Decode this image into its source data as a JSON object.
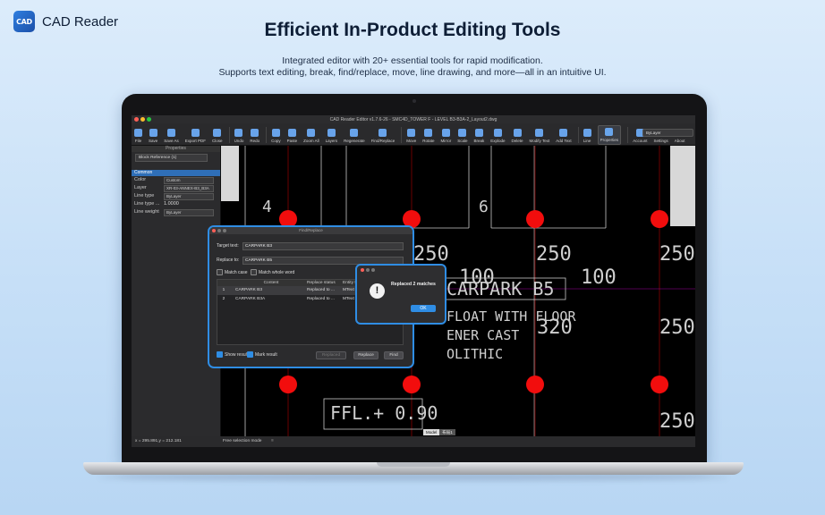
{
  "brand": {
    "logo_text": "CAD",
    "name": "CAD Reader"
  },
  "hero": {
    "title": "Efficient In-Product Editing Tools",
    "subtitle_line1": "Integrated editor with 20+ essential tools for rapid modification.",
    "subtitle_line2": "Supports text editing, break, find/replace, move, line drawing, and more—all in an intuitive UI."
  },
  "window": {
    "title": "CAD Reader Editor v1.7.6-26 - SMC4D_TOWER F - LEVEL B3-B3A-2_Layout2.dwg"
  },
  "toolbar": {
    "items": [
      "File",
      "Save",
      "Save As",
      "Export PDF",
      "Close",
      "Undo",
      "Redo",
      "Copy",
      "Paste",
      "Zoom All",
      "Layers",
      "Regenerate",
      "Find/Replace",
      "Move",
      "Rotate",
      "Mirror",
      "Scale",
      "Break",
      "Explode",
      "Delete",
      "Modify Text",
      "Add Text",
      "Line",
      "Properties",
      "Account",
      "Settings",
      "About"
    ],
    "layer_value": "ByLayer"
  },
  "properties": {
    "title": "Properties",
    "selector": "Block Reference (1)",
    "group": "Common",
    "rows": [
      {
        "key": "Color",
        "value": "Custom"
      },
      {
        "key": "Layer",
        "value": "XR-03-ANNEX-B3_B3A"
      },
      {
        "key": "Line type",
        "value": "ByLayer"
      },
      {
        "key": "Line type ...",
        "value": "1.0000"
      },
      {
        "key": "Line weight",
        "value": "ByLayer"
      }
    ]
  },
  "status": {
    "coords": "x = 295.891,y = 212.181",
    "mode": "Free selection mode",
    "tab_model": "Model",
    "tab_layout": "布局1"
  },
  "find_replace": {
    "title": "Find/Replace",
    "target_label": "Target text:",
    "target_value": "CARPARK B3",
    "replace_label": "Replace to:",
    "replace_value": "CARPARK B5",
    "match_case": "Match case",
    "match_whole": "Match whole word",
    "columns": [
      "",
      "Content",
      "Replace status",
      "Entity type"
    ],
    "rows": [
      {
        "n": "1",
        "content": "CARPARK B3",
        "status": "Replaced to ...",
        "type": "MText"
      },
      {
        "n": "2",
        "content": "CARPARK B3A",
        "status": "Replaced to ...",
        "type": "MText"
      }
    ],
    "show_result": "Show result",
    "mark_result": "Mark result",
    "btn_replaced": "Replaced",
    "btn_replace": "Replace",
    "btn_find": "Find"
  },
  "alert": {
    "message": "Replaced 2 matches",
    "ok": "OK"
  },
  "cad": {
    "nums": [
      "4",
      "6"
    ],
    "dims": [
      "250",
      "250",
      "250",
      "100",
      "100",
      "320",
      "250",
      "250"
    ],
    "texts": [
      "CARPARK B5",
      "FLOAT WITH FLOOR",
      "ENER CAST",
      "OLITHIC",
      "FFL.+ 0.90"
    ]
  },
  "colors": {
    "accent": "#2f8de4",
    "marker": "#f20d0d"
  }
}
